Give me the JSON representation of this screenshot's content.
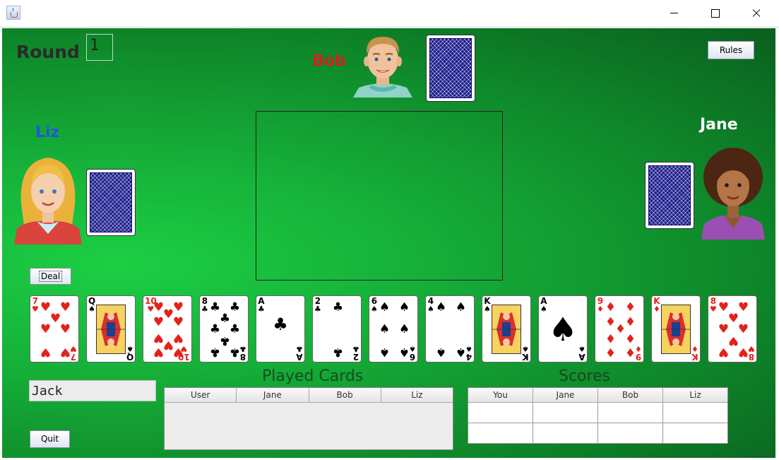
{
  "window": {
    "icon": "java-cup-icon"
  },
  "game": {
    "round_label": "Round",
    "round_value": "1",
    "rules_label": "Rules",
    "deal_label": "Deal",
    "quit_label": "Quit",
    "player_name": "Jack"
  },
  "players": {
    "bob": {
      "name": "Bob",
      "color": "#d42020"
    },
    "liz": {
      "name": "Liz",
      "color": "#1f58d8"
    },
    "jane": {
      "name": "Jane",
      "color": "#ffffff"
    }
  },
  "hand": [
    {
      "rank": "7",
      "suit": "hearts"
    },
    {
      "rank": "Q",
      "suit": "spades"
    },
    {
      "rank": "10",
      "suit": "hearts"
    },
    {
      "rank": "8",
      "suit": "clubs"
    },
    {
      "rank": "A",
      "suit": "clubs"
    },
    {
      "rank": "2",
      "suit": "clubs"
    },
    {
      "rank": "6",
      "suit": "spades"
    },
    {
      "rank": "4",
      "suit": "spades"
    },
    {
      "rank": "K",
      "suit": "spades"
    },
    {
      "rank": "A",
      "suit": "spades"
    },
    {
      "rank": "9",
      "suit": "diamonds"
    },
    {
      "rank": "K",
      "suit": "diamonds"
    },
    {
      "rank": "8",
      "suit": "hearts"
    }
  ],
  "played_cards": {
    "title": "Played Cards",
    "columns": [
      "User",
      "Jane",
      "Bob",
      "Liz"
    ],
    "rows": []
  },
  "scores": {
    "title": "Scores",
    "columns": [
      "You",
      "Jane",
      "Bob",
      "Liz"
    ],
    "rows": [
      [
        "",
        "",
        "",
        ""
      ],
      [
        "",
        "",
        "",
        ""
      ]
    ]
  },
  "colors": {
    "felt": "#16b23a",
    "card_red": "#e2231a",
    "card_back": "#1a1a8c"
  }
}
